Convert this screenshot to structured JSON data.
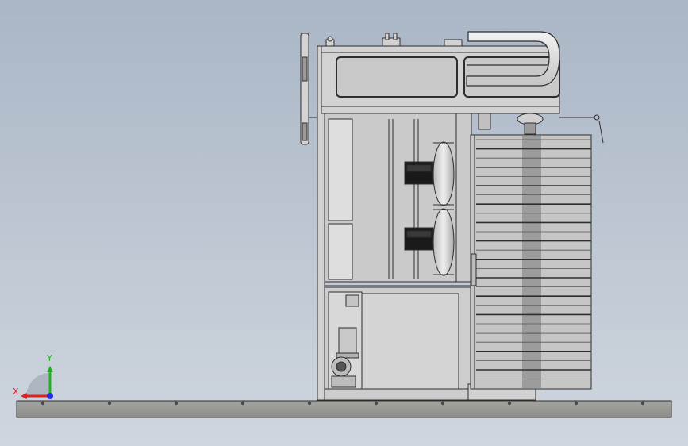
{
  "viewport": {
    "background_top": "#aab6c6",
    "background_bottom": "#cfd6de"
  },
  "model": {
    "body_color": "#d2d2d2",
    "line_color": "#2e2e2e",
    "dark_part_color": "#1a1a1a",
    "fin_band_color": "#7a7a7a",
    "base_color": "#9a9a96"
  },
  "triad": {
    "x_label": "X",
    "y_label": "Y",
    "x_color": "#e02020",
    "y_color": "#20b020",
    "z_color": "#2030e0"
  }
}
